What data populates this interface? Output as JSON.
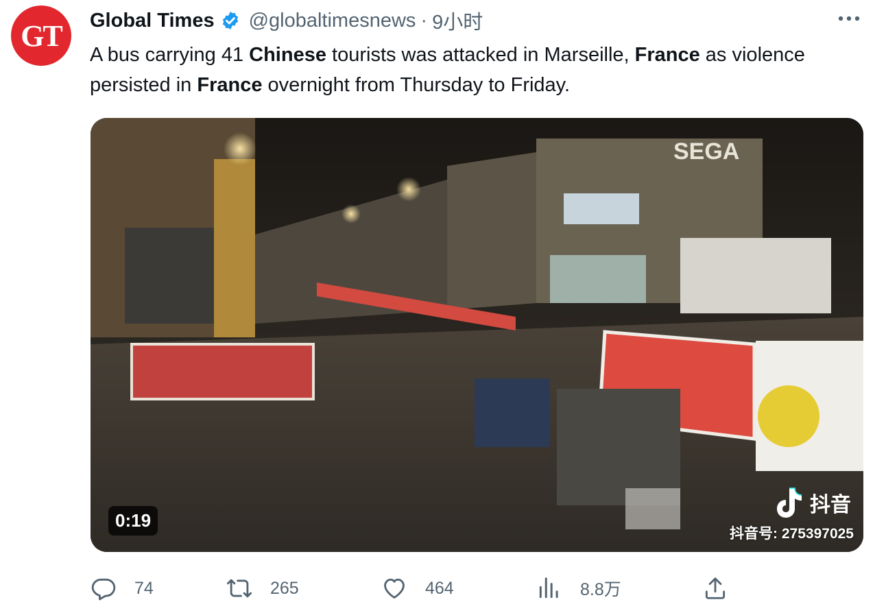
{
  "author": {
    "avatar_text": "GT",
    "name": "Global Times",
    "handle": "@globaltimesnews",
    "separator": "·",
    "time": "9小时"
  },
  "tweet": {
    "parts": [
      {
        "text": "A bus carrying 41 ",
        "bold": false
      },
      {
        "text": "Chinese",
        "bold": true
      },
      {
        "text": " tourists was attacked in Marseille, ",
        "bold": false
      },
      {
        "text": "France",
        "bold": true
      },
      {
        "text": " as violence persisted in ",
        "bold": false
      },
      {
        "text": "France",
        "bold": true
      },
      {
        "text": " overnight from Thursday to Friday.",
        "bold": false
      }
    ]
  },
  "media": {
    "duration": "0:19",
    "watermark_app": "抖音",
    "watermark_id": "抖音号: 275397025",
    "sign_text": "SEGA"
  },
  "actions": {
    "replies": "74",
    "retweets": "265",
    "likes": "464",
    "views": "8.8万"
  },
  "icons": {
    "verified": "verified-badge-icon",
    "more": "more-icon",
    "reply": "reply-icon",
    "retweet": "retweet-icon",
    "like": "like-icon",
    "views": "views-icon",
    "share": "share-icon"
  },
  "colors": {
    "verified": "#1d9bf0",
    "avatar": "#e2282e",
    "secondary_text": "#536471"
  }
}
